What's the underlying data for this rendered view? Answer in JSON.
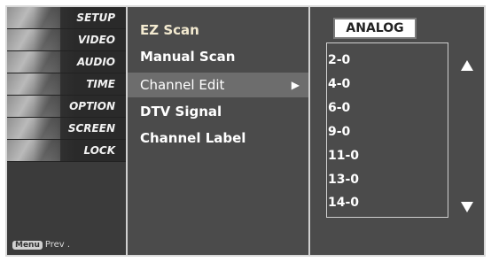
{
  "left_menu": {
    "items": [
      {
        "label": "SETUP"
      },
      {
        "label": "VIDEO"
      },
      {
        "label": "AUDIO"
      },
      {
        "label": "TIME"
      },
      {
        "label": "OPTION"
      },
      {
        "label": "SCREEN"
      },
      {
        "label": "LOCK"
      }
    ],
    "prev_hint": {
      "key": "Menu",
      "label": "Prev ."
    }
  },
  "middle_menu": {
    "items": [
      {
        "label": "EZ Scan"
      },
      {
        "label": "Manual Scan"
      },
      {
        "label": "Channel Edit",
        "arrow": "▶"
      },
      {
        "label": "DTV Signal"
      },
      {
        "label": "Channel Label"
      }
    ]
  },
  "right_panel": {
    "mode_button": "ANALOG",
    "channels": [
      "2-0",
      "4-0",
      "6-0",
      "9-0",
      "11-0",
      "13-0",
      "14-0"
    ],
    "scroll_up_icon": "up-triangle-icon",
    "scroll_down_icon": "down-triangle-icon"
  },
  "colors": {
    "panel_bg": "#4b4b4b",
    "left_bg": "#3b3b3b",
    "active_row": "#6d6d6d"
  }
}
